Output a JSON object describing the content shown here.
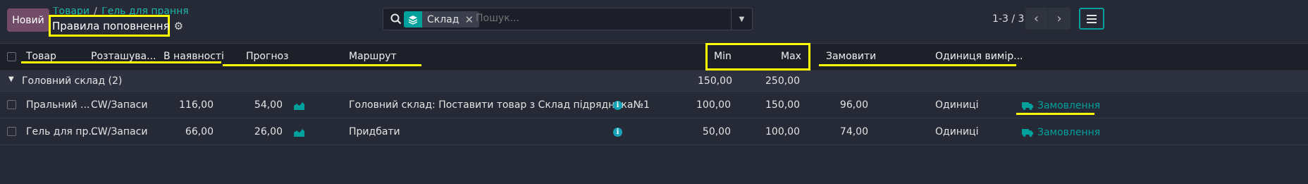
{
  "toolbar": {
    "new_label": "Новий",
    "breadcrumb": [
      "Товари",
      "Гель для прання"
    ],
    "title": "Правила поповнення"
  },
  "search": {
    "facet_label": "Склад",
    "placeholder": "Пошук..."
  },
  "pager": {
    "value": "1-3 / 3"
  },
  "columns": {
    "product": "Товар",
    "location": "Розташува...",
    "on_hand": "В наявності",
    "forecast": "Прогноз",
    "route": "Маршрут",
    "min": "Min",
    "max": "Max",
    "order": "Замовити",
    "uom": "Одиниця вимір..."
  },
  "group": {
    "label": "Головний склад (2)",
    "min": "150,00",
    "max": "250,00"
  },
  "rows": [
    {
      "product": "Пральний ...",
      "location": "CW/Запаси",
      "on_hand": "116,00",
      "forecast": "54,00",
      "route": "Головний склад: Поставити товар з Склад підрядника№1",
      "min": "100,00",
      "max": "150,00",
      "order": "96,00",
      "uom": "Одиниці",
      "action": "Замовлення"
    },
    {
      "product": "Гель для пр...",
      "location": "CW/Запаси",
      "on_hand": "66,00",
      "forecast": "26,00",
      "route": "Придбати",
      "min": "50,00",
      "max": "100,00",
      "order": "74,00",
      "uom": "Одиниці",
      "action": "Замовлення"
    }
  ],
  "colors": {
    "accent": "#00a09d",
    "primary": "#714b67",
    "highlight": "#ffff00",
    "background": "#262a36"
  }
}
